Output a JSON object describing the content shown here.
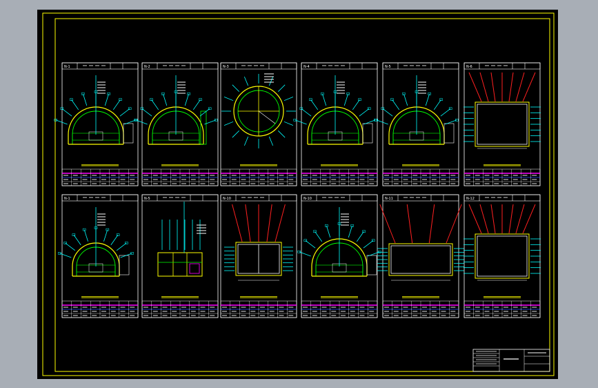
{
  "colors": {
    "desktop": "#a8aeb6",
    "canvas": "#000000",
    "frame": "#ffff00",
    "line_white": "#ffffff",
    "cyan": "#00ffff",
    "yellow": "#ffff00",
    "green": "#00ff00",
    "red": "#ff2020",
    "magenta": "#ff00ff",
    "blue": "#3050ff"
  },
  "panels": [
    {
      "id": "N-1",
      "shape": "arch"
    },
    {
      "id": "N-2",
      "shape": "arch-cover"
    },
    {
      "id": "N-3",
      "shape": "circle"
    },
    {
      "id": "N-4",
      "shape": "arch"
    },
    {
      "id": "N-5",
      "shape": "arch"
    },
    {
      "id": "N-6",
      "shape": "rect-red"
    },
    {
      "id": "N-1",
      "shape": "arch-small"
    },
    {
      "id": "N-5",
      "shape": "frame"
    },
    {
      "id": "N-10",
      "shape": "rect-red-small"
    },
    {
      "id": "N-10",
      "shape": "arch-wide"
    },
    {
      "id": "N-11",
      "shape": "rect-red-wide"
    },
    {
      "id": "N-12",
      "shape": "rect-red"
    }
  ]
}
